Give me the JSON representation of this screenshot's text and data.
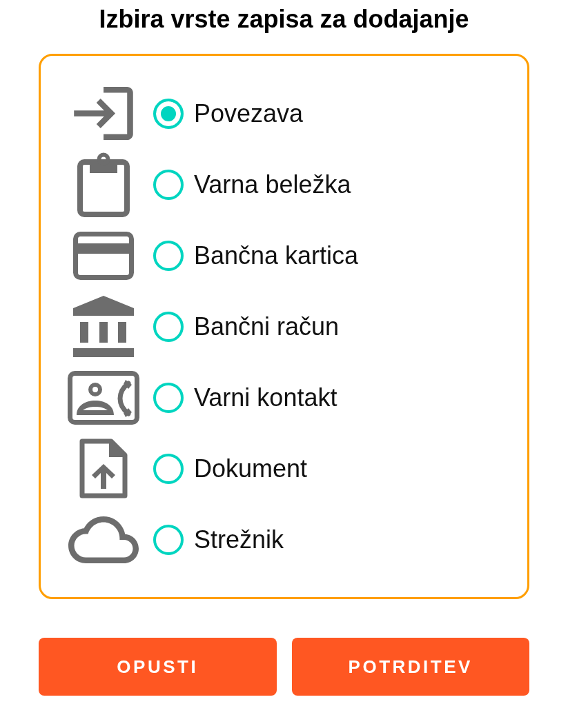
{
  "title": "Izbira vrste zapisa za dodajanje",
  "options": [
    {
      "kind": "login",
      "label": "Povezava",
      "selected": true
    },
    {
      "kind": "note",
      "label": "Varna beležka",
      "selected": false
    },
    {
      "kind": "card",
      "label": "Bančna kartica",
      "selected": false
    },
    {
      "kind": "bank",
      "label": "Bančni račun",
      "selected": false
    },
    {
      "kind": "contact",
      "label": "Varni kontakt",
      "selected": false
    },
    {
      "kind": "document",
      "label": "Dokument",
      "selected": false
    },
    {
      "kind": "server",
      "label": "Strežnik",
      "selected": false
    }
  ],
  "buttons": [
    {
      "label": "OPUSTI"
    },
    {
      "label": "POTRDITEV"
    }
  ]
}
